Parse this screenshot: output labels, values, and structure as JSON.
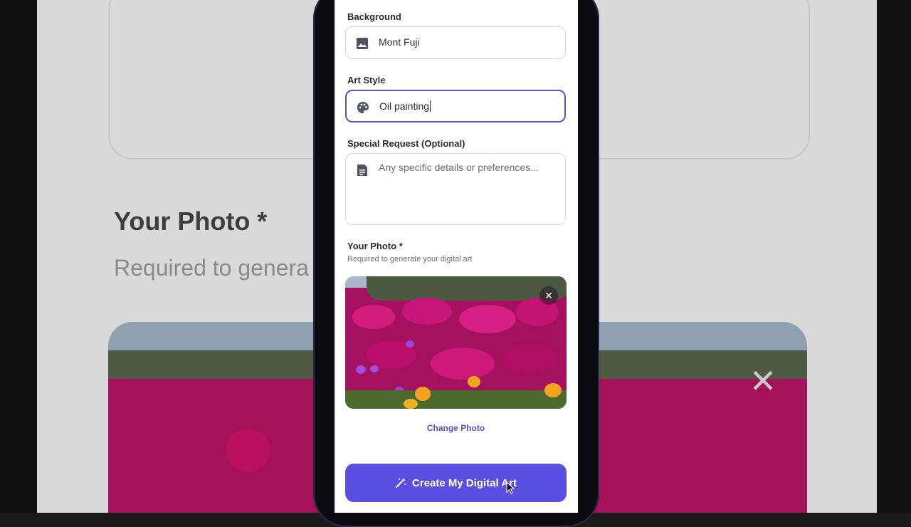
{
  "form": {
    "background_label": "Background",
    "background_value": "Mont Fuji",
    "art_style_label": "Art Style",
    "art_style_value": "Oil painting",
    "special_request_label": "Special Request (Optional)",
    "special_request_placeholder": "Any specific details or preferences...",
    "photo_label": "Your Photo *",
    "photo_hint": "Required to generate your digital art",
    "change_photo": "Change Photo",
    "submit_label": "Create My Digital Art",
    "close_glyph": "✕"
  },
  "background": {
    "title": "Your Photo *",
    "subtitle": "Required to genera"
  },
  "colors": {
    "accent": "#5a4fe0",
    "focus_border": "#5b4fd1"
  },
  "icons": {
    "background": "image-icon",
    "art_style": "palette-icon",
    "special_request": "document-icon",
    "submit": "magic-wand-icon",
    "remove_photo": "close-icon"
  }
}
